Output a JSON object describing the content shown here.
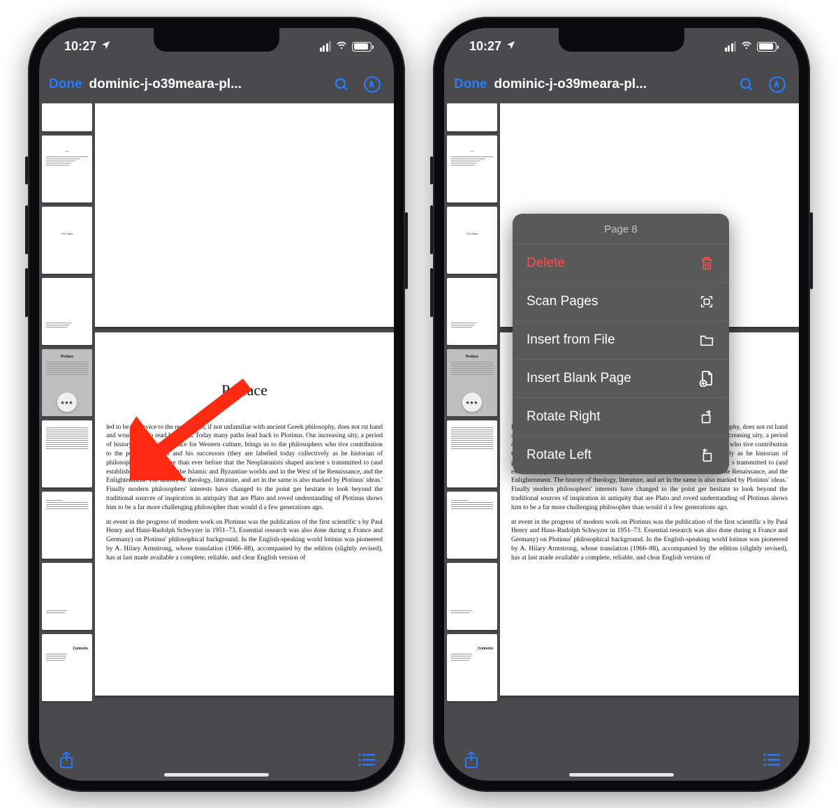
{
  "status": {
    "time": "10:27"
  },
  "nav": {
    "done": "Done",
    "title": "dominic-j-o39meara-pl..."
  },
  "doc": {
    "preface_heading": "Preface",
    "para1": "led to be of service to the reader who, if not unfamiliar with ancient Greek philosophy, does not rst hand and would like to read his work. Today many paths lead back to Plotinus. Our increasing uity, a period of history of great importance for Western culture, brings us to the philosophers who tive contribution to the period, Plotinus and his successors (they are labelled today collectively as he historian of philosophy is more aware than ever before that the Neoplatonists shaped ancient s transmitted to (and established) philosophy in the Islamic and Byzantine worlds and in the West of he Renaissance, and the Enlightenment. The history of theology, literature, and art in the same is also marked by Plotinus' ideas.' Finally modern philosophers' interests have changed to the point ger hesitate to look beyond the traditional sources of inspiration in antiquity that are Plato and roved understanding of Plotinus shows him to be a far more challenging philosopher than would d a few generations ago.",
    "para2": "nt event in the progress of modern work on Plotinus was the publication of the first scientific s by Paul Henry and Hans-Rudolph Schwyzer in 1951–73. Essential research was also done during n France and Germany) on Plotinus' philosophical background. In the English-speaking world lotinus was pioneered by A. Hilary Armstrong, whose translation (1966–88), accompanied by the edition (slightly revised), has at last made available a complete, reliable, and clear English version of"
  },
  "ctx": {
    "header": "Page 8",
    "delete": "Delete",
    "scan": "Scan Pages",
    "insert_file": "Insert from File",
    "insert_blank": "Insert Blank Page",
    "rotate_right": "Rotate Right",
    "rotate_left": "Rotate Left"
  },
  "colors": {
    "accent": "#257cff",
    "destructive": "#ff4d4d"
  }
}
